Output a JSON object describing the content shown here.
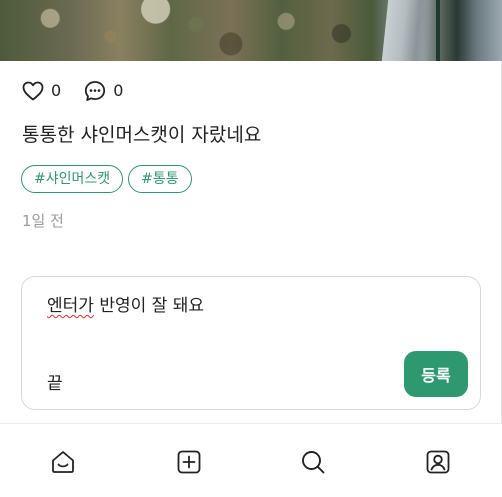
{
  "post": {
    "like_count": "0",
    "comment_count": "0",
    "title": "통통한 샤인머스캣이 자랐네요",
    "tags": [
      "#샤인머스캣",
      "#통통"
    ],
    "time_ago": "1일 전"
  },
  "comment_form": {
    "text_line1_underlined": "엔터가",
    "text_line1_rest": " 반영이 잘 돼요",
    "text_line2": "끝",
    "submit_label": "등록"
  },
  "bottom_nav": {
    "items": [
      "home-icon",
      "add-icon",
      "search-icon",
      "profile-icon"
    ]
  },
  "colors": {
    "accent": "#2e9870",
    "text": "#222222",
    "muted": "#9a9a9a"
  }
}
